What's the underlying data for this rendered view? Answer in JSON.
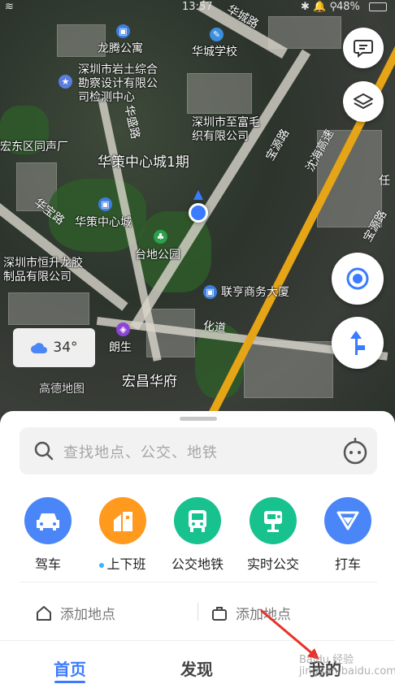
{
  "status_bar": {
    "time": "13:57",
    "battery": "48%",
    "left_glyph": "≋"
  },
  "map": {
    "pois": [
      {
        "name": "龙腾公寓",
        "pin": "building-icon"
      },
      {
        "name": "深圳市岩土综合\n勘察设计有限公\n司检测中心",
        "pin": "star-icon"
      },
      {
        "name": "华城学校",
        "pin": "school-icon"
      },
      {
        "name": "深圳市至富毛\n织有限公司",
        "pin": ""
      },
      {
        "name": "宏东区同声厂",
        "pin": ""
      },
      {
        "name": "华策中心城1期",
        "pin": ""
      },
      {
        "name": "华策中心城",
        "pin": "building-icon"
      },
      {
        "name": "台地公园",
        "pin": "park-icon"
      },
      {
        "name": "深圳市恒升龙胶\n制品有限公司",
        "pin": ""
      },
      {
        "name": "联亨商务大厦",
        "pin": "building-icon"
      },
      {
        "name": "朗生",
        "pin": "shop-icon"
      },
      {
        "name": "宏昌华府",
        "pin": ""
      },
      {
        "name": "高德地图",
        "pin": ""
      }
    ],
    "roads": [
      "华城路",
      "宝源路",
      "沈海高速",
      "华宝路",
      "华盛路",
      "宝源路",
      "化道",
      "任"
    ],
    "weather": {
      "temp": "34°",
      "icon": "cloud-icon"
    },
    "buttons": {
      "message": "message-icon",
      "layers": "layers-icon",
      "locate": "locate-icon",
      "navigate": "navigate-icon"
    }
  },
  "panel": {
    "search_placeholder": "查找地点、公交、地铁",
    "quick_actions": [
      {
        "label": "驾车",
        "color": "#4a86f7",
        "icon": "car-icon"
      },
      {
        "label": "上下班",
        "color": "#ff9a1f",
        "icon": "commute-icon",
        "dot": true
      },
      {
        "label": "公交地铁",
        "color": "#18c28f",
        "icon": "bus-icon"
      },
      {
        "label": "实时公交",
        "color": "#18c28f",
        "icon": "realtime-bus-icon"
      },
      {
        "label": "打车",
        "color": "#4a86f7",
        "icon": "taxi-icon"
      }
    ],
    "add_places": [
      {
        "label": "添加地点",
        "icon": "home-icon"
      },
      {
        "label": "添加地点",
        "icon": "briefcase-icon"
      }
    ]
  },
  "tabbar": {
    "tabs": [
      {
        "label": "首页",
        "active": true
      },
      {
        "label": "发现",
        "active": false
      },
      {
        "label": "我的",
        "active": false
      }
    ]
  },
  "watermark": "Baidu 经验\njingyan.baidu.com",
  "annotation_color": "#e8322a"
}
